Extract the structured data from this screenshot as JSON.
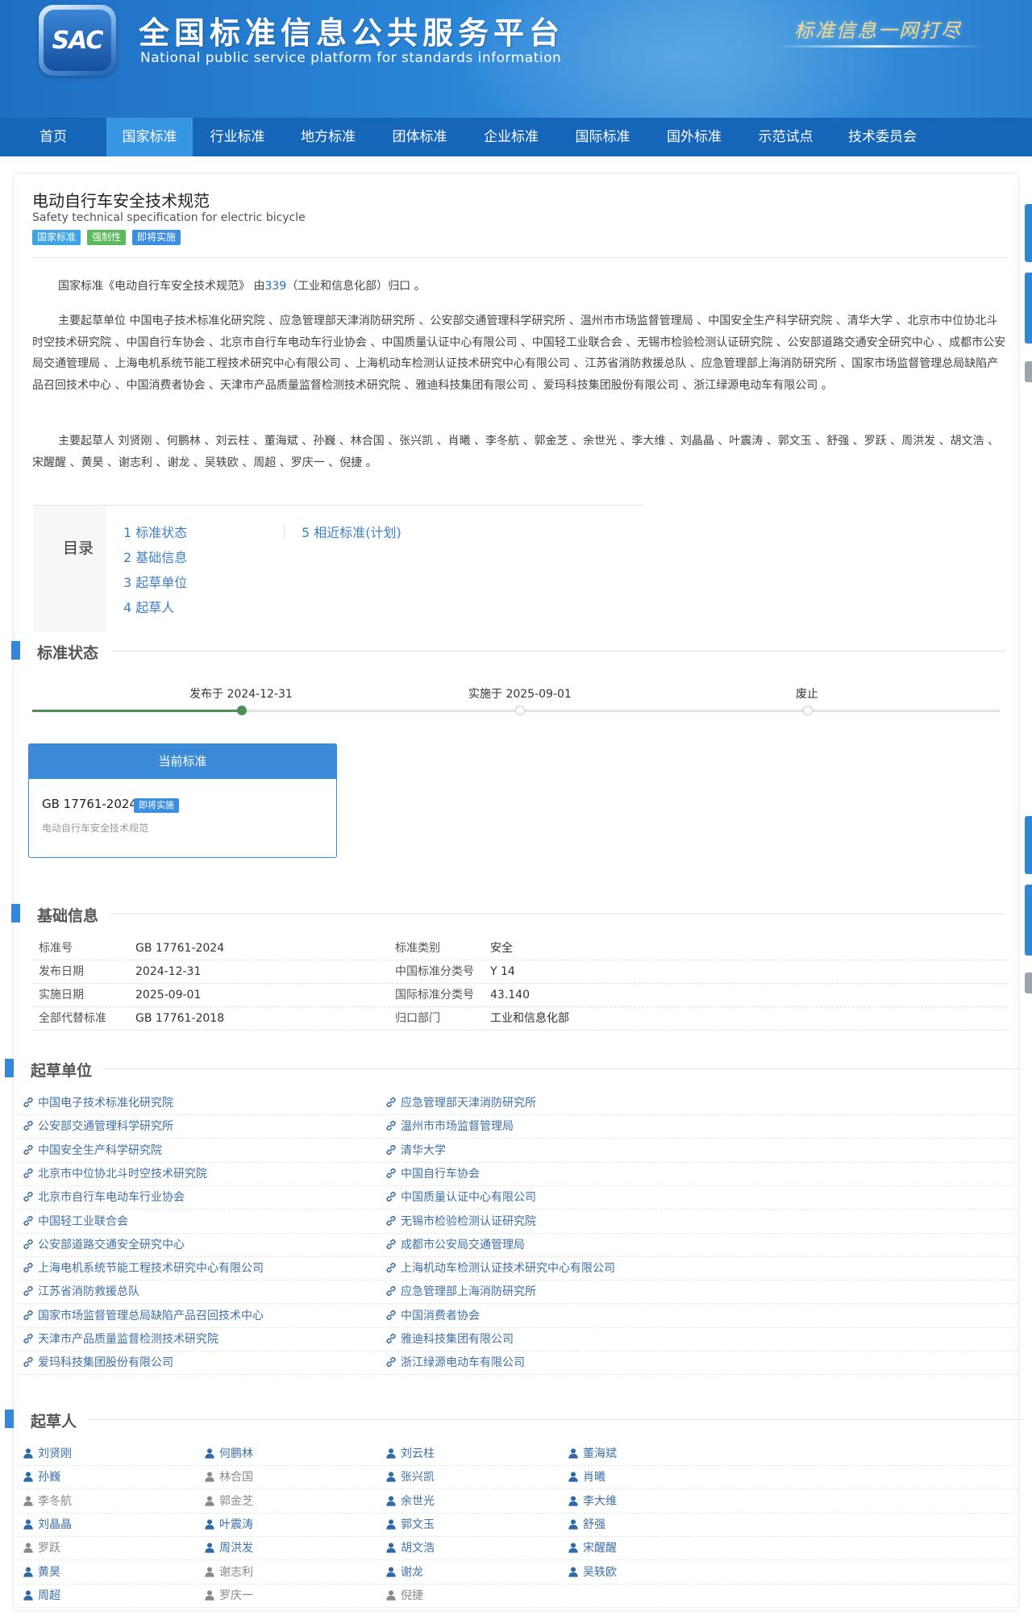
{
  "header": {
    "logo_text": "SAC",
    "title": "全国标准信息公共服务平台",
    "subtitle": "National public service platform  for standards information",
    "slogan": "标准信息一网打尽"
  },
  "nav": {
    "items": [
      "首页",
      "国家标准",
      "行业标准",
      "地方标准",
      "团体标准",
      "企业标准",
      "国际标准",
      "国外标准",
      "示范试点",
      "技术委员会"
    ],
    "active": "国家标准"
  },
  "standard": {
    "title_zh": "电动自行车安全技术规范",
    "title_en": "Safety technical specification for electric bicycle",
    "tags": [
      "国家标准",
      "强制性",
      "即将实施"
    ]
  },
  "intro": {
    "p1_pre": "国家标准《电动自行车安全技术规范》 由",
    "p1_link1": "339",
    "p1_link2": "（工业和信息化部）",
    "p1_post": "归口 。",
    "p2": "主要起草单位 中国电子技术标准化研究院 、应急管理部天津消防研究所 、公安部交通管理科学研究所 、温州市市场监督管理局 、中国安全生产科学研究院 、清华大学 、北京市中位协北斗时空技术研究院 、中国自行车协会 、北京市自行车电动车行业协会 、中国质量认证中心有限公司 、中国轻工业联合会 、无锡市检验检测认证研究院 、公安部道路交通安全研究中心 、成都市公安局交通管理局 、上海电机系统节能工程技术研究中心有限公司 、上海机动车检测认证技术研究中心有限公司 、江苏省消防救援总队 、应急管理部上海消防研究所 、国家市场监督管理总局缺陷产品召回技术中心 、中国消费者协会 、天津市产品质量监督检测技术研究院 、雅迪科技集团有限公司 、爱玛科技集团股份有限公司 、浙江绿源电动车有限公司 。",
    "p3": "主要起草人 刘贤刚 、何鹏林 、刘云柱 、董海斌 、孙巍 、林合国 、张兴凯 、肖曦 、李冬航 、郭金芝 、余世光 、李大维 、刘晶晶 、叶震涛 、郭文玉 、舒强 、罗跃 、周洪发 、胡文浩 、宋醒醒 、黄昊 、谢志利 、谢龙 、吴轶欧 、周超 、罗庆一 、倪捷 。"
  },
  "toc": {
    "label": "目录",
    "items": [
      "1  标准状态",
      "2  基础信息",
      "3  起草单位",
      "4  起草人",
      "5  相近标准(计划)"
    ]
  },
  "status": {
    "section_title": "标准状态",
    "steps": [
      "发布于 2024-12-31",
      "实施于 2025-09-01",
      "废止"
    ],
    "completed_steps": 1,
    "current_header": "当前标准",
    "current_code": "GB 17761-2024",
    "current_badge": "即将实施",
    "current_name": "电动自行车安全技术规范"
  },
  "basic": {
    "section_title": "基础信息",
    "rows": [
      {
        "k1": "标准号",
        "v1": "GB 17761-2024",
        "k2": "标准类别",
        "v2": "安全"
      },
      {
        "k1": "发布日期",
        "v1": "2024-12-31",
        "k2": "中国标准分类号",
        "v2": "Y 14"
      },
      {
        "k1": "实施日期",
        "v1": "2025-09-01",
        "k2": "国际标准分类号",
        "v2": "43.140"
      },
      {
        "k1": "全部代替标准",
        "v1": "GB 17761-2018",
        "k2": "归口部门",
        "v2": "工业和信息化部"
      }
    ]
  },
  "orgs": {
    "section_title": "起草单位",
    "items": [
      "中国电子技术标准化研究院",
      "应急管理部天津消防研究所",
      "公安部交通管理科学研究所",
      "温州市市场监督管理局",
      "中国安全生产科学研究院",
      "清华大学",
      "北京市中位协北斗时空技术研究院",
      "中国自行车协会",
      "北京市自行车电动车行业协会",
      "中国质量认证中心有限公司",
      "中国轻工业联合会",
      "无锡市检验检测认证研究院",
      "公安部道路交通安全研究中心",
      "成都市公安局交通管理局",
      "上海电机系统节能工程技术研究中心有限公司",
      "上海机动车检测认证技术研究中心有限公司",
      "江苏省消防救援总队",
      "应急管理部上海消防研究所",
      "国家市场监督管理总局缺陷产品召回技术中心",
      "中国消费者协会",
      "天津市产品质量监督检测技术研究院",
      "雅迪科技集团有限公司",
      "爱玛科技集团股份有限公司",
      "浙江绿源电动车有限公司"
    ]
  },
  "people": {
    "section_title": "起草人",
    "items": [
      {
        "name": "刘贤刚",
        "linked": true
      },
      {
        "name": "何鹏林",
        "linked": true
      },
      {
        "name": "刘云柱",
        "linked": true
      },
      {
        "name": "董海斌",
        "linked": true
      },
      {
        "name": "孙巍",
        "linked": true
      },
      {
        "name": "林合国",
        "linked": false
      },
      {
        "name": "张兴凯",
        "linked": true
      },
      {
        "name": "肖曦",
        "linked": true
      },
      {
        "name": "李冬航",
        "linked": false
      },
      {
        "name": "郭金芝",
        "linked": false
      },
      {
        "name": "余世光",
        "linked": true
      },
      {
        "name": "李大维",
        "linked": true
      },
      {
        "name": "刘晶晶",
        "linked": true
      },
      {
        "name": "叶震涛",
        "linked": true
      },
      {
        "name": "郭文玉",
        "linked": true
      },
      {
        "name": "舒强",
        "linked": true
      },
      {
        "name": "罗跃",
        "linked": false
      },
      {
        "name": "周洪发",
        "linked": true
      },
      {
        "name": "胡文浩",
        "linked": true
      },
      {
        "name": "宋醒醒",
        "linked": true
      },
      {
        "name": "黄昊",
        "linked": true
      },
      {
        "name": "谢志利",
        "linked": false
      },
      {
        "name": "谢龙",
        "linked": true
      },
      {
        "name": "吴轶欧",
        "linked": true
      },
      {
        "name": "周超",
        "linked": true
      },
      {
        "name": "罗庆一",
        "linked": false
      },
      {
        "name": "倪捷",
        "linked": false
      }
    ]
  },
  "colors": {
    "brand": "#1565b8",
    "nav_active": "#3796e4",
    "section_bar": "#3588d9",
    "progress": "#4d8f54",
    "link": "#3d6fa8"
  }
}
